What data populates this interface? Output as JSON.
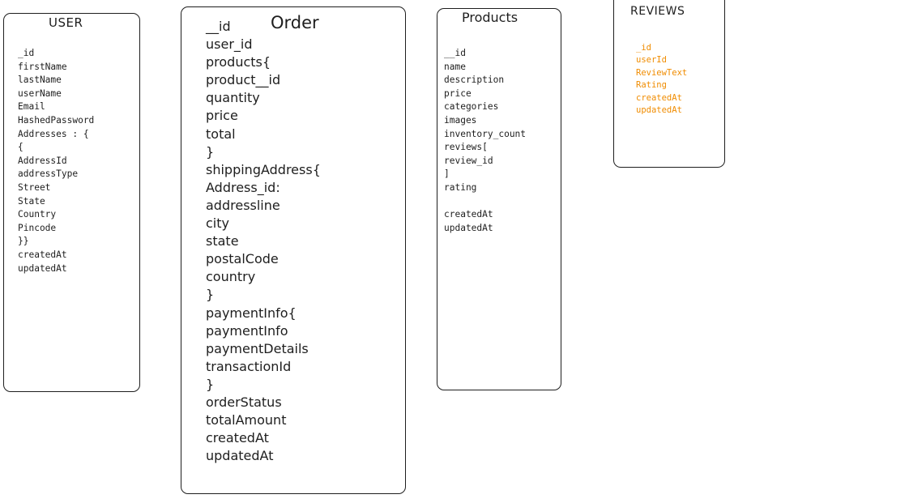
{
  "theme": {
    "ink": "#1e1e1e",
    "accent": "#f08c00",
    "background": "#ffffff"
  },
  "user": {
    "title": "USER",
    "fields": [
      "_id",
      "firstName",
      "lastName",
      "userName",
      "Email",
      "HashedPassword",
      "Addresses : {",
      "{",
      "AddressId",
      "addressType",
      "Street",
      "State",
      "Country",
      "Pincode",
      "}}",
      "createdAt",
      "updatedAt"
    ]
  },
  "order": {
    "title": "Order",
    "fields": [
      "__id",
      "user_id",
      "products{",
      "product__id",
      "quantity",
      "price",
      "total",
      "}",
      "shippingAddress{",
      "Address_id:",
      "addressline",
      "city",
      "state",
      "postalCode",
      "country",
      "}",
      "paymentInfo{",
      "paymentInfo",
      "paymentDetails",
      "transactionId",
      "}",
      "orderStatus",
      "totalAmount",
      "createdAt",
      "updatedAt"
    ]
  },
  "products": {
    "title": "Products",
    "fields": [
      "__id",
      "name",
      "description",
      "price",
      "categories",
      "images",
      "inventory_count",
      "reviews[",
      "review_id",
      "]",
      "rating",
      "",
      "createdAt",
      "updatedAt"
    ]
  },
  "reviews": {
    "title": "REVIEWS",
    "fields": [
      "_id",
      "userId",
      "ReviewText",
      "Rating",
      "createdAt",
      "updatedAt"
    ]
  }
}
